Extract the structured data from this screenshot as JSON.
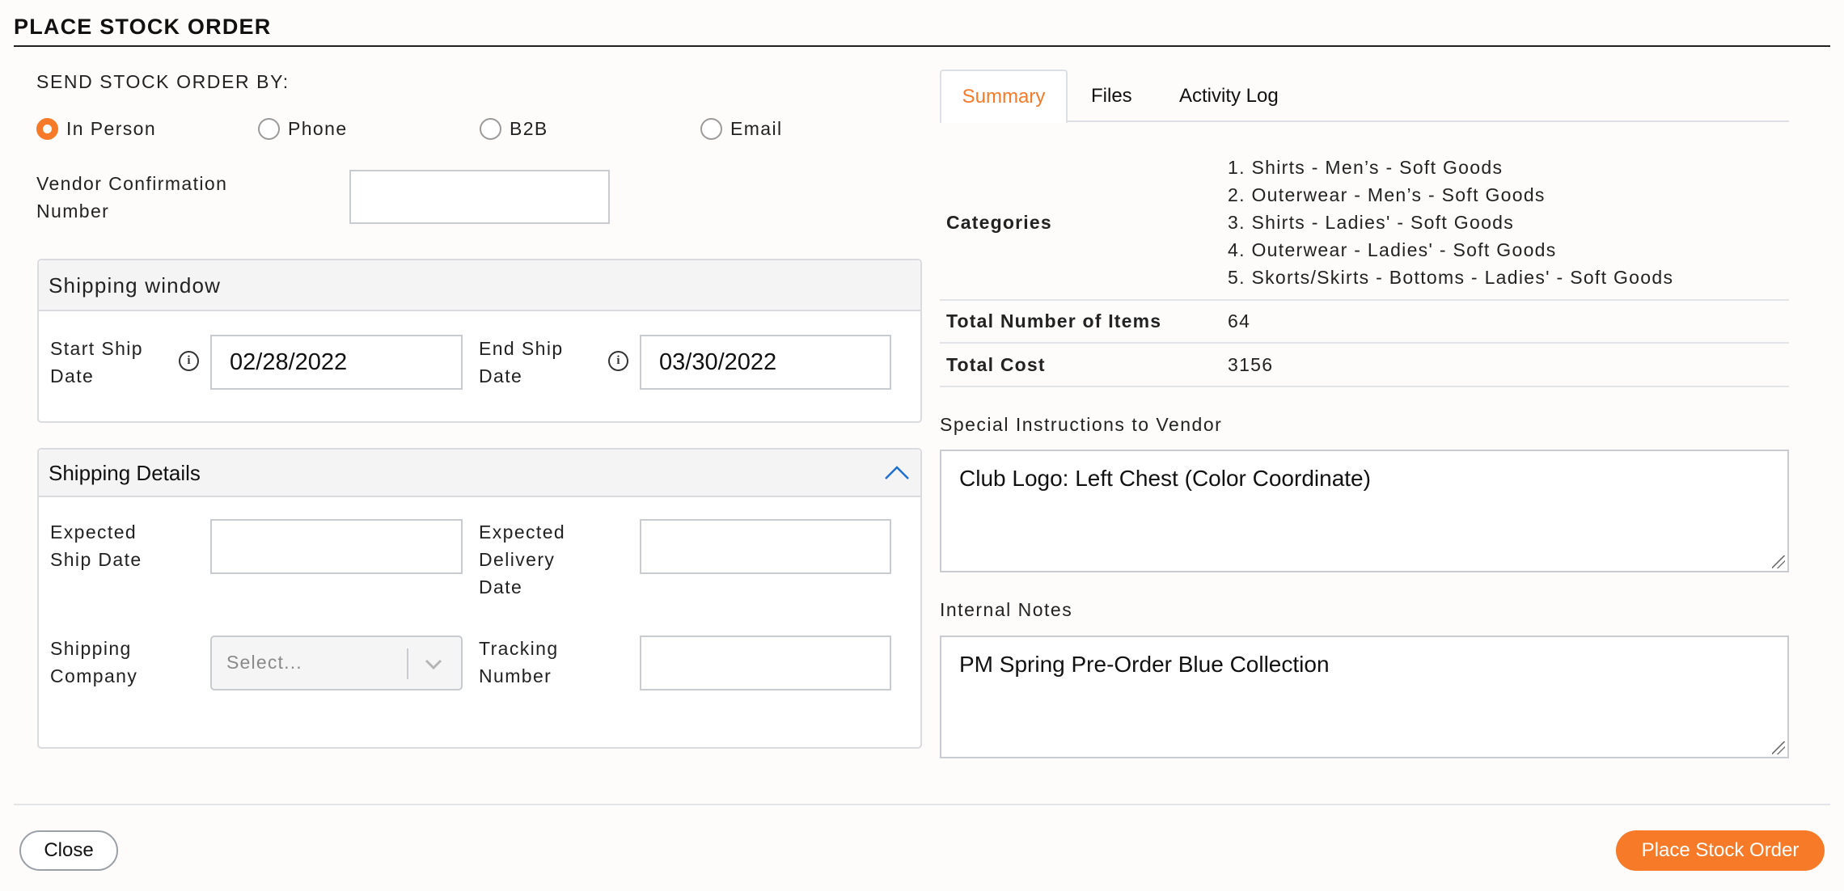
{
  "modal": {
    "title": "PLACE STOCK ORDER"
  },
  "send_by": {
    "label": "SEND STOCK ORDER BY:",
    "options": [
      {
        "label": "In Person",
        "selected": true
      },
      {
        "label": "Phone",
        "selected": false
      },
      {
        "label": "B2B",
        "selected": false
      },
      {
        "label": "Email",
        "selected": false
      }
    ]
  },
  "vendor_confirmation": {
    "label_line1": "Vendor Confirmation",
    "label_line2": "Number",
    "value": ""
  },
  "shipping_window": {
    "title": "Shipping window",
    "start_label_line1": "Start Ship",
    "start_label_line2": "Date",
    "start_value": "02/28/2022",
    "end_label_line1": "End Ship",
    "end_label_line2": "Date",
    "end_value": "03/30/2022",
    "info_glyph": "i"
  },
  "shipping_details": {
    "title": "Shipping Details",
    "expected_ship_line1": "Expected",
    "expected_ship_line2": "Ship Date",
    "expected_ship_value": "",
    "expected_delivery_line1": "Expected",
    "expected_delivery_line2": "Delivery",
    "expected_delivery_line3": "Date",
    "expected_delivery_value": "",
    "company_line1": "Shipping",
    "company_line2": "Company",
    "company_placeholder": "Select...",
    "tracking_line1": "Tracking",
    "tracking_line2": "Number",
    "tracking_value": ""
  },
  "tabs": [
    {
      "label": "Summary",
      "active": true
    },
    {
      "label": "Files",
      "active": false
    },
    {
      "label": "Activity Log",
      "active": false
    }
  ],
  "summary": {
    "categories_label": "Categories",
    "categories": [
      "1. Shirts - Men’s - Soft Goods",
      "2. Outerwear - Men’s - Soft Goods",
      "3. Shirts - Ladies' - Soft Goods",
      "4. Outerwear - Ladies' - Soft Goods",
      "5. Skorts/Skirts - Bottoms - Ladies' - Soft Goods"
    ],
    "total_items_label": "Total Number of Items",
    "total_items_value": "64",
    "total_cost_label": "Total Cost",
    "total_cost_value": "3156"
  },
  "special_instructions": {
    "label": "Special Instructions to Vendor",
    "value": "Club Logo: Left Chest (Color Coordinate)"
  },
  "internal_notes": {
    "label": "Internal Notes",
    "value": "PM Spring Pre-Order Blue Collection"
  },
  "footer": {
    "close_label": "Close",
    "submit_label": "Place Stock Order"
  },
  "colors": {
    "accent": "#f67a27",
    "chevron_blue": "#1f6fd1"
  }
}
